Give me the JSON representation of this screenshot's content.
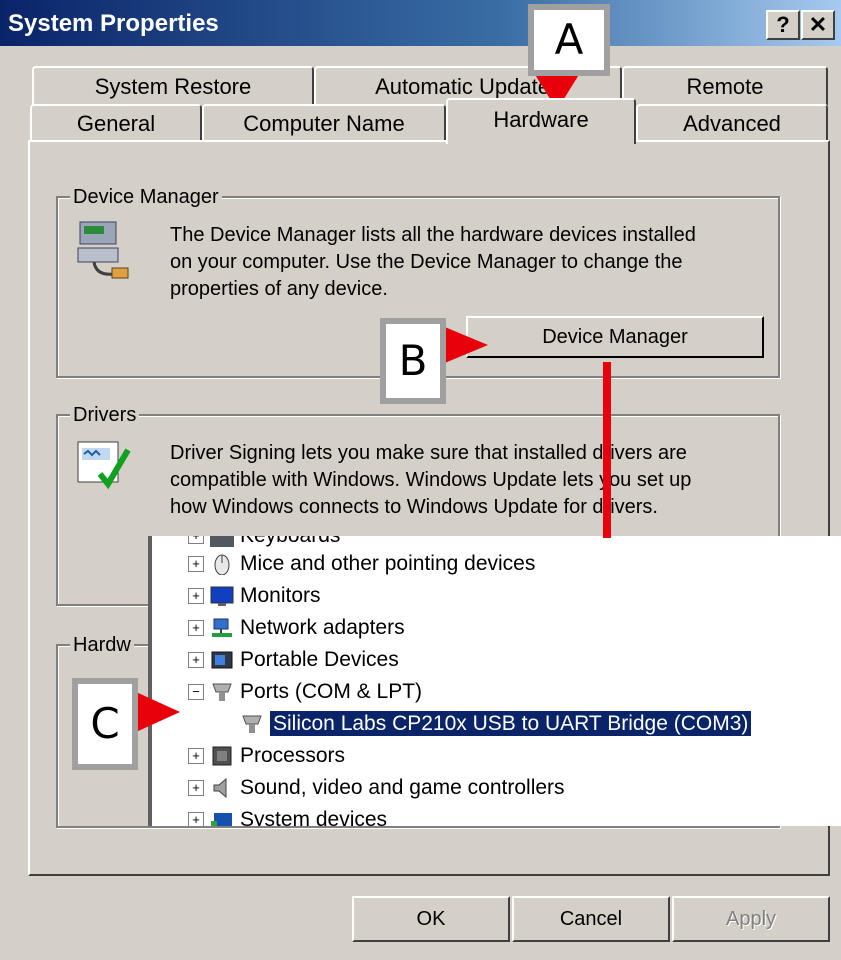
{
  "window": {
    "title": "System Properties",
    "help_label": "?",
    "close_label": "✕"
  },
  "tabs": {
    "row_back": [
      "System Restore",
      "Automatic Updates",
      "Remote"
    ],
    "row_front": [
      "General",
      "Computer Name",
      "Hardware",
      "Advanced"
    ],
    "active": "Hardware"
  },
  "device_manager_group": {
    "label": "Device Manager",
    "description_lines": [
      "The Device Manager lists all the hardware devices installed",
      "on your computer. Use the Device Manager to change the",
      "properties of any device."
    ],
    "button_label": "Device Manager"
  },
  "drivers_group": {
    "label": "Drivers",
    "description_lines": [
      "Driver Signing lets you make sure that installed drivers are",
      "compatible with Windows. Windows Update lets you set up",
      "how Windows connects to Windows Update for drivers."
    ]
  },
  "hardware_group": {
    "label": "Hardw"
  },
  "device_tree": {
    "items": [
      {
        "label": "Keyboards",
        "expander": "+"
      },
      {
        "label": "Mice and other pointing devices",
        "expander": "+"
      },
      {
        "label": "Monitors",
        "expander": "+"
      },
      {
        "label": "Network adapters",
        "expander": "+"
      },
      {
        "label": "Portable Devices",
        "expander": "+"
      },
      {
        "label": "Ports (COM & LPT)",
        "expander": "−"
      },
      {
        "label": "Silicon Labs CP210x USB to UART Bridge (COM3)",
        "expander": "",
        "selected": true
      },
      {
        "label": "Processors",
        "expander": "+"
      },
      {
        "label": "Sound, video and game controllers",
        "expander": "+"
      },
      {
        "label": "System devices",
        "expander": "+"
      }
    ]
  },
  "buttons": {
    "ok": "OK",
    "cancel": "Cancel",
    "apply": "Apply"
  },
  "callouts": {
    "a": "A",
    "b": "B",
    "c": "C"
  },
  "colors": {
    "arrow": "#e8000a",
    "selection": "#0a246a",
    "face": "#d4d0c8"
  }
}
